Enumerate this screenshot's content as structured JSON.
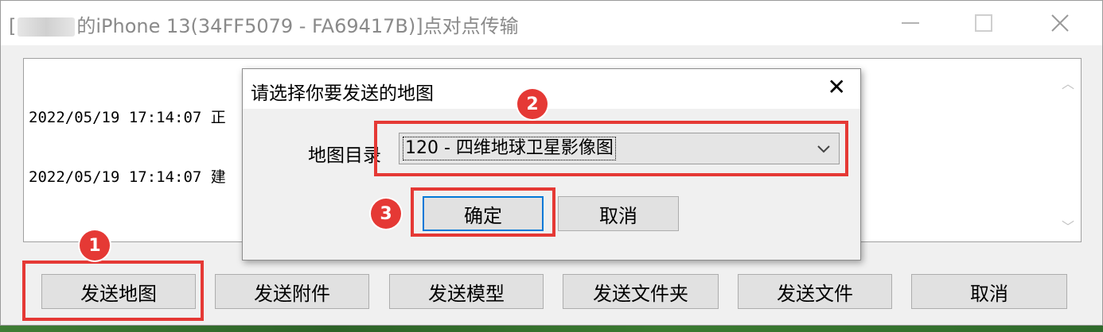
{
  "window": {
    "title_prefix": "[",
    "title_suffix": "的iPhone 13(34FF5079 - FA69417B)]点对点传输",
    "minimize_icon": "minimize-icon",
    "maximize_icon": "maximize-icon",
    "close_icon": "close-icon"
  },
  "log": {
    "lines": [
      "2022/05/19 17:14:07 正",
      "2022/05/19 17:14:07 建"
    ]
  },
  "buttons": {
    "send_map": "发送地图",
    "send_attachment": "发送附件",
    "send_model": "发送模型",
    "send_folder": "发送文件夹",
    "send_file": "发送文件",
    "cancel": "取消"
  },
  "dialog": {
    "title": "请选择你要发送的地图",
    "close_symbol": "✕",
    "label": "地图目录",
    "select_value": "120 - 四维地球卫星影像图",
    "ok": "确定",
    "cancel": "取消"
  },
  "annotations": {
    "badge1": "1",
    "badge2": "2",
    "badge3": "3",
    "color": "#e53935"
  }
}
